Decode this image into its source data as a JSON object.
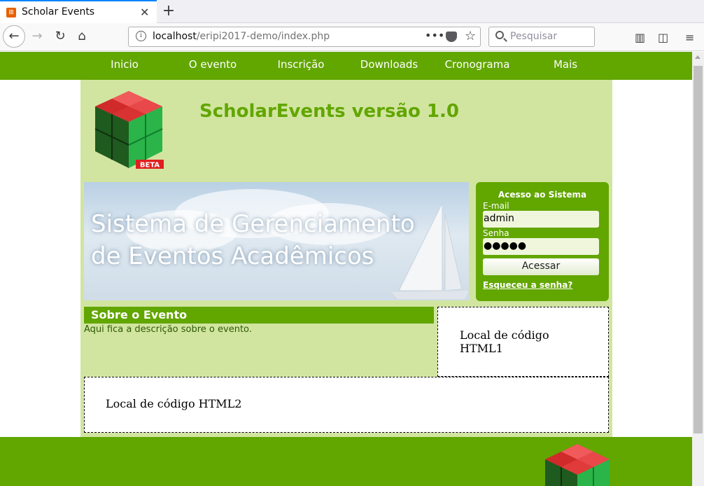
{
  "browser": {
    "tab_title": "Scholar Events",
    "url_host": "localhost",
    "url_path": "/eripi2017-demo/index.php",
    "search_placeholder": "Pesquisar"
  },
  "menu": {
    "items": [
      "Inicio",
      "O evento",
      "Inscrição",
      "Downloads",
      "Cronograma",
      "Mais"
    ]
  },
  "header": {
    "title": "ScholarEvents versão 1.0",
    "logo_badge": "BETA"
  },
  "banner": {
    "line1": "Sistema de Gerenciamento",
    "line2": "de Eventos Acadêmicos"
  },
  "login": {
    "title": "Acesso ao Sistema",
    "email_label": "E-mail",
    "email_value": "admin",
    "password_label": "Senha",
    "password_mask": "●●●●●",
    "submit_label": "Acessar",
    "forgot_link": "Esqueceu a senha?"
  },
  "about": {
    "heading": "Sobre o Evento",
    "text": "Aqui fica a descrição sobre o evento."
  },
  "html_blocks": {
    "html1": "Local de código HTML1",
    "html2": "Local de código HTML2"
  },
  "colors": {
    "brand_green": "#62a600",
    "content_bg": "#d1e5a0"
  }
}
